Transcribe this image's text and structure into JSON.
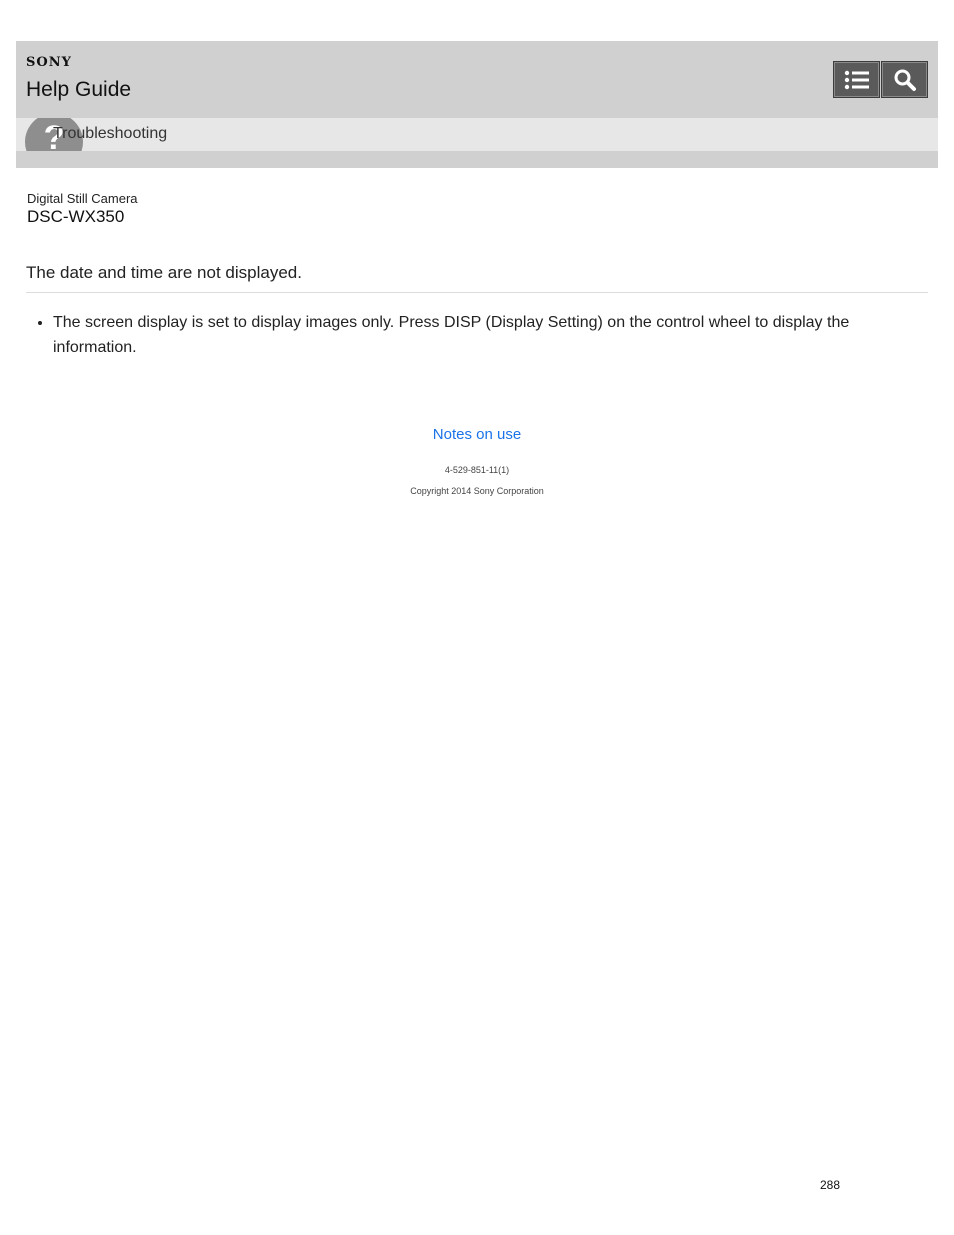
{
  "header": {
    "brand": "SONY",
    "title": "Help Guide",
    "toc_icon": "list-icon",
    "search_icon": "search-icon",
    "section_icon": "question-icon",
    "section_icon_glyph": "?",
    "section_label": "Troubleshooting"
  },
  "product": {
    "type": "Digital Still Camera",
    "model": "DSC-WX350"
  },
  "main": {
    "heading": "The date and time are not displayed.",
    "items": [
      "The screen display is set to display images only. Press DISP (Display Setting) on the control wheel to display the information."
    ]
  },
  "footer": {
    "link": "Notes on use",
    "doc_code": "4-529-851-11(1)",
    "copyright": "Copyright 2014 Sony Corporation"
  },
  "page_number": "288",
  "colors": {
    "header_bg": "#d0d0d0",
    "section_bg": "#e7e7e7",
    "button_bg": "#5a5a5a",
    "link": "#1a73e8"
  }
}
